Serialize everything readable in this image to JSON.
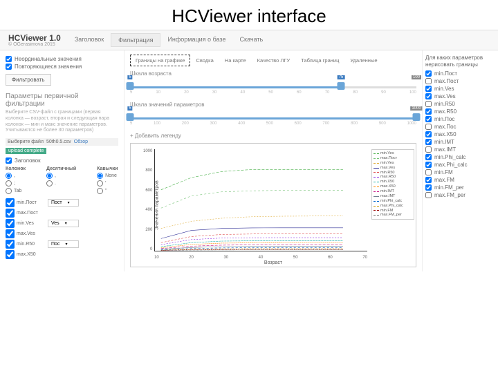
{
  "slide_title": "HCViewer interface",
  "brand": {
    "name": "HCViewer 1.0",
    "sub": "© OGerasimova 2015"
  },
  "topnav": [
    {
      "label": "Заголовок"
    },
    {
      "label": "Фильтрация",
      "active": true
    },
    {
      "label": "Информация о базе"
    },
    {
      "label": "Скачать"
    }
  ],
  "left": {
    "chk1": "Неординальные значения",
    "chk2": "Повторяющиеся значения",
    "filter_btn": "Фильтровать",
    "section": "Параметры первичной фильтрации",
    "help": "Выберите CSV-файл с границами (первая колонка — возраст, вторая и следующая пара колонок — мин и макс значение параметров. Учитываются не более 30 параметров)",
    "filebar": {
      "browse": "Выберите файл",
      "name": "50th0.5.csv",
      "review": "Обзор"
    },
    "upload": "upload complete",
    "chk_header": "Заголовок",
    "radio_heads": [
      "Колонок",
      "Десятичный",
      "Кавычки"
    ],
    "radio_cols": [
      [
        ",",
        ";",
        "Tab"
      ],
      [
        ",",
        "."
      ],
      [
        "None",
        "'",
        "\""
      ]
    ],
    "params": [
      {
        "chk": "min.Пост",
        "dd": "Пост"
      },
      {
        "chk": "max.Пост",
        "dd": null
      },
      {
        "chk": "min.Ves",
        "dd": "Ves"
      },
      {
        "chk": "max.Ves",
        "dd": null
      },
      {
        "chk": "min.R50",
        "dd": "Пос"
      },
      {
        "chk": "max.X50",
        "dd": null
      }
    ]
  },
  "mid": {
    "subtabs": [
      {
        "label": "Границы на графике",
        "active": true
      },
      {
        "label": "Сводка"
      },
      {
        "label": "На карте"
      },
      {
        "label": "Качество ЛГУ"
      },
      {
        "label": "Таблица границ"
      },
      {
        "label": "Удаленные"
      }
    ],
    "age_label": "Шкала возраста",
    "age_slider": {
      "min": 5,
      "max": 100,
      "lo": 5,
      "hi": 75,
      "badge_right": "100",
      "ticks": [
        "5",
        "10",
        "20",
        "30",
        "40",
        "50",
        "60",
        "70",
        "80",
        "90",
        "100"
      ]
    },
    "val_label": "Шкала значений параметров",
    "val_slider": {
      "min": 5,
      "max": 1000,
      "lo": 5,
      "hi": 1000,
      "badge_right": "1000",
      "ticks": [
        "5",
        "100",
        "200",
        "300",
        "400",
        "500",
        "600",
        "700",
        "800",
        "900",
        "1000"
      ]
    },
    "add_legend": "+ Добавить легенду"
  },
  "chart_data": {
    "type": "line",
    "xlabel": "Возраст",
    "ylabel": "Значения параметров",
    "xlim": [
      5,
      75
    ],
    "ylim": [
      0,
      1000
    ],
    "yticks": [
      "0",
      "200",
      "400",
      "600",
      "800",
      "1000"
    ],
    "xticks": [
      "10",
      "20",
      "30",
      "40",
      "50",
      "60",
      "70"
    ],
    "series": [
      {
        "name": "min.Ves",
        "color": "#4db24d",
        "dash": "4 2",
        "y": [
          600,
          720,
          780,
          800,
          800,
          800,
          800
        ]
      },
      {
        "name": "max.Пост",
        "color": "#7ac47a",
        "dash": "3 3",
        "y": [
          420,
          540,
          580,
          590,
          595,
          596,
          596
        ]
      },
      {
        "name": "min.Ves",
        "color": "#e0b040",
        "dash": "2 2",
        "y": [
          220,
          290,
          320,
          335,
          340,
          342,
          342
        ]
      },
      {
        "name": "max.Ves",
        "color": "#333399",
        "dash": "0",
        "y": [
          120,
          200,
          220,
          225,
          226,
          226,
          226
        ]
      },
      {
        "name": "min.R50",
        "color": "#e05050",
        "dash": "3 2",
        "y": [
          80,
          140,
          160,
          165,
          168,
          168,
          168
        ]
      },
      {
        "name": "max.R50",
        "color": "#8a2be2",
        "dash": "2 2",
        "y": [
          60,
          110,
          125,
          128,
          129,
          129,
          129
        ]
      },
      {
        "name": "min.X50",
        "color": "#20b2aa",
        "dash": "3 1",
        "y": [
          40,
          80,
          95,
          98,
          99,
          99,
          99
        ]
      },
      {
        "name": "max.X50",
        "color": "#ff8c00",
        "dash": "2 1",
        "y": [
          30,
          62,
          75,
          78,
          79,
          79,
          79
        ]
      },
      {
        "name": "min.IMT",
        "color": "#c71585",
        "dash": "4 2",
        "y": [
          22,
          45,
          55,
          58,
          59,
          59,
          59
        ]
      },
      {
        "name": "max.IMT",
        "color": "#708090",
        "dash": "0",
        "y": [
          15,
          32,
          40,
          42,
          43,
          43,
          43
        ]
      },
      {
        "name": "min.Phi_calc",
        "color": "#0066cc",
        "dash": "3 3",
        "y": [
          10,
          22,
          28,
          30,
          30,
          30,
          30
        ]
      },
      {
        "name": "max.Phi_calc",
        "color": "#cc9900",
        "dash": "2 2",
        "y": [
          6,
          15,
          19,
          20,
          20,
          20,
          20
        ]
      },
      {
        "name": "min.FM",
        "color": "#990000",
        "dash": "2 1",
        "y": [
          4,
          10,
          13,
          14,
          14,
          14,
          14
        ]
      },
      {
        "name": "max.FM_per",
        "color": "#666666",
        "dash": "1 1",
        "y": [
          2,
          6,
          8,
          9,
          9,
          9,
          9
        ]
      }
    ]
  },
  "right": {
    "heading": "Для каких параметров нерисовать границы",
    "items": [
      "min.Пост",
      "max.Пост",
      "min.Ves",
      "max.Ves",
      "min.R50",
      "max.R50",
      "min.Пос",
      "max.Пос",
      "max.X50",
      "min.IMT",
      "max.IMT",
      "min.Phi_calc",
      "max.Phi_calc",
      "min.FM",
      "max.FM",
      "min.FM_per",
      "max.FM_per"
    ]
  }
}
